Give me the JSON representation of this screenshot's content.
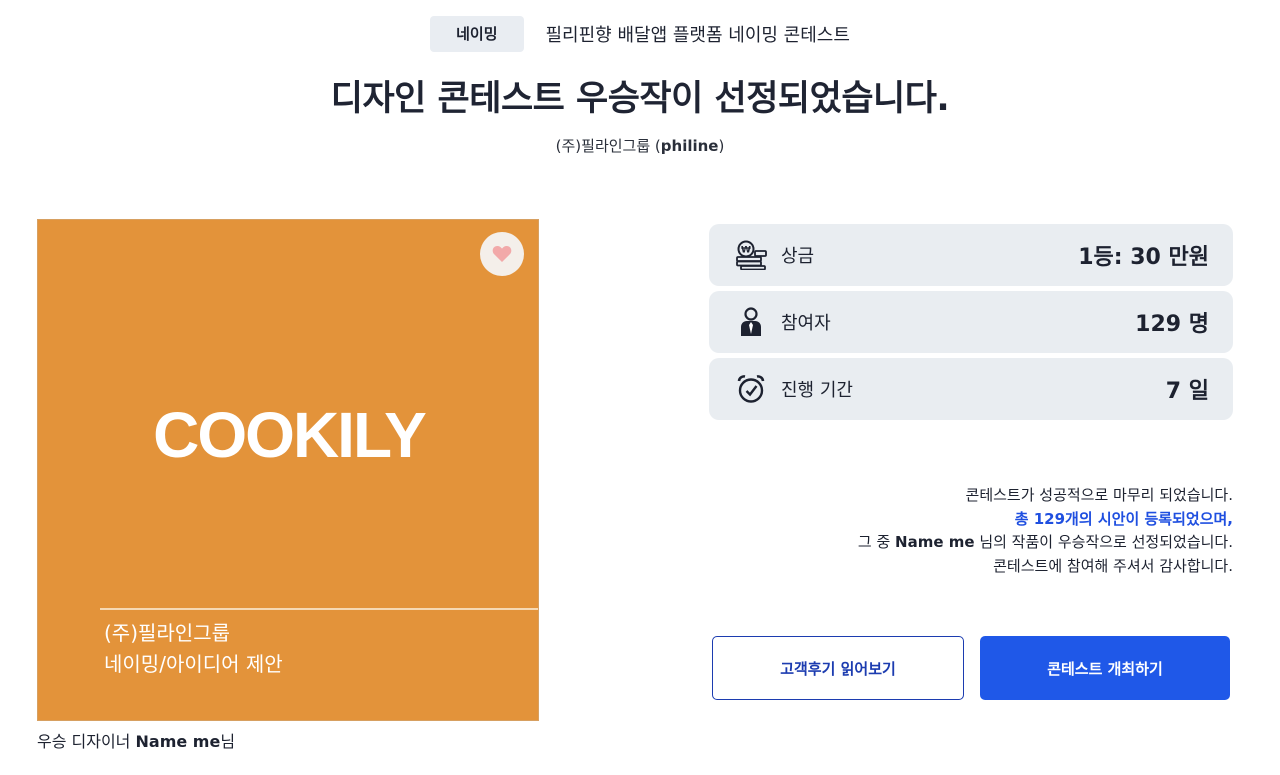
{
  "header": {
    "category_badge": "네이밍",
    "contest_name": "필리핀향 배달앱 플랫폼 네이밍 콘테스트",
    "title": "디자인 콘테스트 우승작이 선정되었습니다.",
    "host_prefix": "(주)필라인그룹 (",
    "host_english": "philine",
    "host_suffix": ")"
  },
  "winner_image": {
    "brand_name": "COOKILY",
    "caption_line1": "(주)필라인그룹",
    "caption_line2": "네이밍/아이디어 제안",
    "background_color": "#e3933a",
    "like_icon": "heart-icon"
  },
  "designer_credit": {
    "prefix": "우승 디자이너 ",
    "name": "Name me",
    "suffix": "님"
  },
  "stats": [
    {
      "icon": "money-stack-icon",
      "label": "상금",
      "value": "1등: 30 만원"
    },
    {
      "icon": "person-icon",
      "label": "참여자",
      "value": "129 명"
    },
    {
      "icon": "alarm-clock-icon",
      "label": "진행 기간",
      "value": "7 일"
    }
  ],
  "summary": {
    "line1": "콘테스트가 성공적으로 마무리 되었습니다.",
    "line2": "총 129개의 시안이 등록되었으며,",
    "line3_prefix": "그 중 ",
    "line3_name": "Name me",
    "line3_suffix": " 님의 작품이 우승작으로 선정되었습니다.",
    "line4": "콘테스트에 참여해 주셔서 감사합니다."
  },
  "buttons": {
    "reviews": "고객후기 읽어보기",
    "host_contest": "콘테스트 개최하기"
  },
  "colors": {
    "accent_blue": "#1f58e8",
    "card_bg": "#e9edf1",
    "image_orange": "#e3933a"
  }
}
